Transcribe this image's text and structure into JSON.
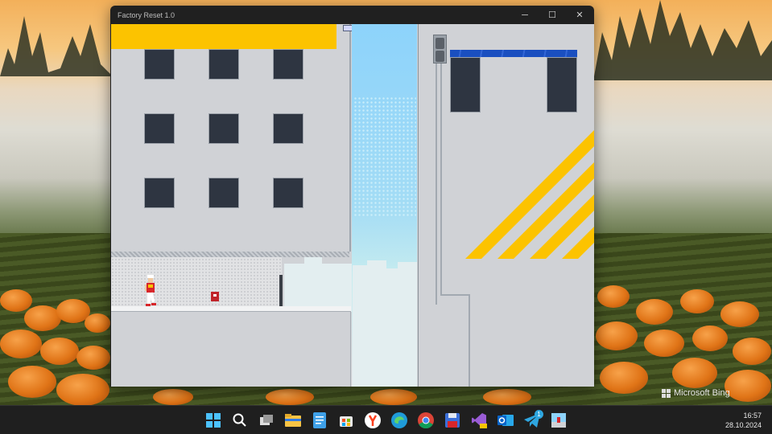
{
  "window": {
    "title": "Factory Reset 1.0",
    "controls": {
      "minimize": "─",
      "maximize": "☐",
      "close": "✕"
    }
  },
  "game": {
    "scene": "rooftop-level",
    "colors": {
      "wall": "#d0d2d6",
      "window_pane": "#2e3541",
      "hazard_yellow": "#fcc300",
      "awning_blue": "#1a4fc0",
      "sky_top": "#8dd3fb",
      "player_shirt": "#d8262a",
      "pickup": "#c0242a"
    }
  },
  "desktop": {
    "wallpaper": "pumpkin-field-at-sunrise",
    "watermark": "Microsoft Bing"
  },
  "taskbar": {
    "pinned": [
      {
        "name": "start",
        "icon": "windows-logo-icon"
      },
      {
        "name": "search",
        "icon": "search-icon"
      },
      {
        "name": "task-view",
        "icon": "task-view-icon"
      },
      {
        "name": "file-explorer",
        "icon": "folder-icon"
      },
      {
        "name": "notepad",
        "icon": "notepad-icon"
      },
      {
        "name": "microsoft-store",
        "icon": "store-icon"
      },
      {
        "name": "yandex-browser",
        "icon": "yandex-icon"
      },
      {
        "name": "edge",
        "icon": "edge-icon"
      },
      {
        "name": "chrome",
        "icon": "chrome-icon"
      },
      {
        "name": "floppy-app",
        "icon": "floppy-icon"
      },
      {
        "name": "visual-studio",
        "icon": "visual-studio-icon"
      },
      {
        "name": "outlook",
        "icon": "outlook-icon"
      },
      {
        "name": "telegram",
        "icon": "telegram-icon",
        "badge": "1"
      },
      {
        "name": "game-app",
        "icon": "game-icon"
      }
    ],
    "time": "16:57",
    "date": "28.10.2024"
  }
}
